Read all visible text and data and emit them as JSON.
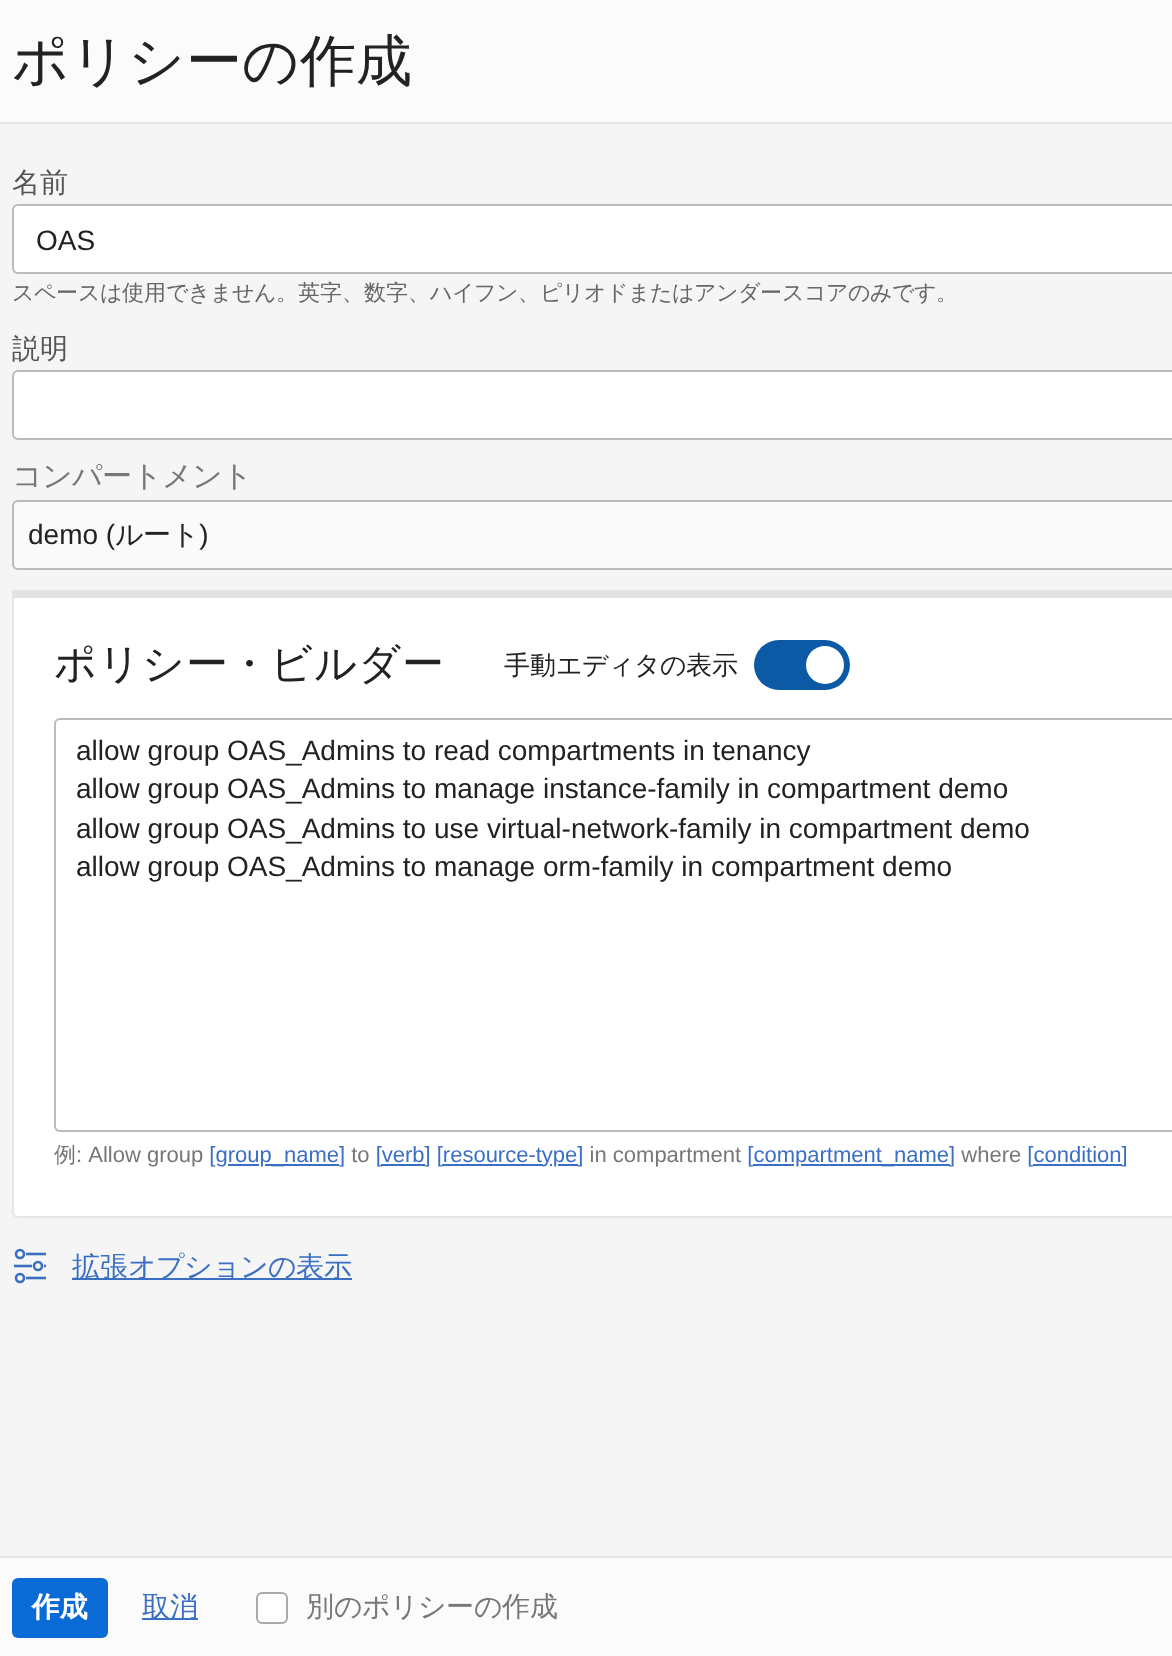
{
  "header": {
    "title": "ポリシーの作成"
  },
  "name_field": {
    "label": "名前",
    "value": "OAS",
    "hint": "スペースは使用できません。英字、数字、ハイフン、ピリオドまたはアンダースコアのみです。"
  },
  "description_field": {
    "label": "説明"
  },
  "compartment_field": {
    "label": "コンパートメント",
    "value": "demo (ルート)"
  },
  "policy_builder": {
    "title": "ポリシー・ビルダー",
    "manual_editor": {
      "label": "手動エディタの表示",
      "on": true
    },
    "statements": [
      "allow group OAS_Admins to read compartments in tenancy",
      "allow group OAS_Admins to manage instance-family in compartment demo",
      "allow group OAS_Admins to use virtual-network-family in compartment demo",
      "allow group OAS_Admins to manage orm-family in compartment demo"
    ],
    "example": [
      {
        "kind": "text",
        "text": "例: Allow group "
      },
      {
        "kind": "link",
        "text": "[group_name]"
      },
      {
        "kind": "text",
        "text": " to "
      },
      {
        "kind": "link",
        "text": "[verb]"
      },
      {
        "kind": "gap"
      },
      {
        "kind": "link",
        "text": "[resource-type]"
      },
      {
        "kind": "text",
        "text": " in compartment "
      },
      {
        "kind": "link",
        "text": "[compartment_name]"
      },
      {
        "kind": "text",
        "text": " where "
      },
      {
        "kind": "link",
        "text": "[condition]"
      }
    ]
  },
  "advanced_link": "拡張オプションの表示",
  "footer": {
    "create_button": "作成",
    "cancel_link": "取消",
    "create_another": {
      "label": "別のポリシーの作成",
      "checked": false
    }
  }
}
